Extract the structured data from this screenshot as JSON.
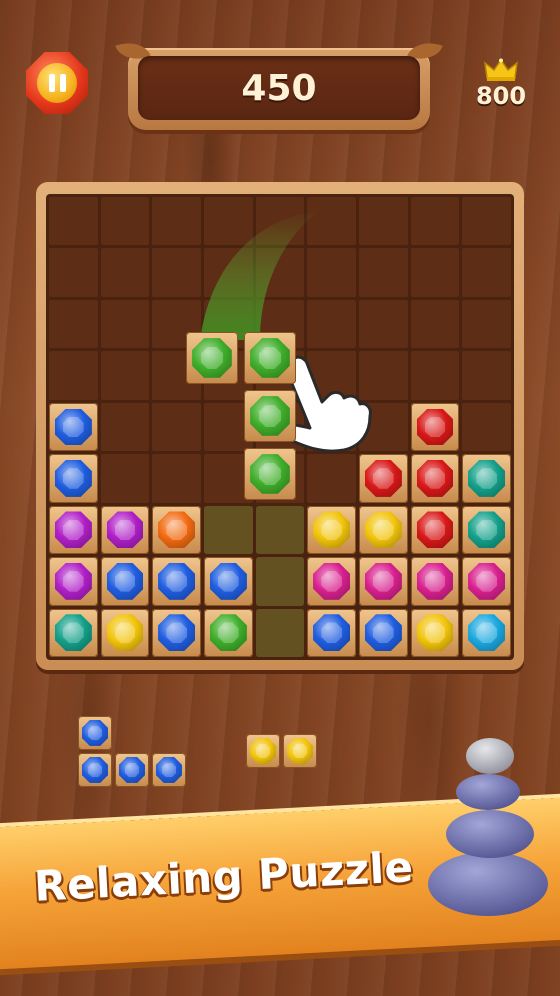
{
  "hud": {
    "score": "450",
    "best_score": "800"
  },
  "banner": {
    "text": "Relaxing Puzzle"
  },
  "colors": {
    "blue": "#1f5de0",
    "green": "#3fae2a",
    "purple": "#b01fc8",
    "orange": "#f26a10",
    "yellow": "#f2c40c",
    "red": "#d91818",
    "teal": "#13a08a",
    "pink": "#d8208e",
    "cyan": "#1aa8e0"
  },
  "board": {
    "rows": 9,
    "cols": 9,
    "cells": [
      [
        "",
        "",
        "",
        "",
        "",
        "",
        "",
        "",
        ""
      ],
      [
        "",
        "",
        "",
        "",
        "",
        "",
        "",
        "",
        ""
      ],
      [
        "",
        "",
        "",
        "",
        "",
        "",
        "",
        "",
        ""
      ],
      [
        "",
        "",
        "",
        "",
        "",
        "",
        "",
        "",
        ""
      ],
      [
        "blue",
        "",
        "",
        "",
        "",
        "",
        "",
        "red",
        ""
      ],
      [
        "blue",
        "",
        "",
        "",
        "",
        "",
        "red",
        "red",
        "teal"
      ],
      [
        "purple",
        "purple",
        "orange",
        "ghost",
        "ghost",
        "yellow",
        "yellow",
        "red",
        "teal"
      ],
      [
        "purple",
        "blue",
        "blue",
        "blue",
        "ghost",
        "pink",
        "pink",
        "pink",
        "pink"
      ],
      [
        "teal",
        "yellow",
        "blue",
        "green",
        "ghost",
        "blue",
        "blue",
        "yellow",
        "cyan"
      ]
    ]
  },
  "drag_piece": {
    "color": "green",
    "cells": [
      [
        0,
        0
      ],
      [
        0,
        1
      ],
      [
        1,
        1
      ],
      [
        2,
        1
      ]
    ]
  },
  "tray": [
    {
      "color": "blue",
      "cells": [
        [
          0,
          0
        ],
        [
          1,
          0
        ],
        [
          1,
          1
        ],
        [
          1,
          2
        ]
      ]
    },
    {
      "color": "yellow",
      "cells": [
        [
          0,
          0
        ],
        [
          0,
          1
        ]
      ]
    }
  ],
  "icons": {
    "pause": "pause-icon",
    "crown": "crown-icon",
    "hand": "pointing-hand-icon",
    "stones": "stacked-stones-icon"
  }
}
